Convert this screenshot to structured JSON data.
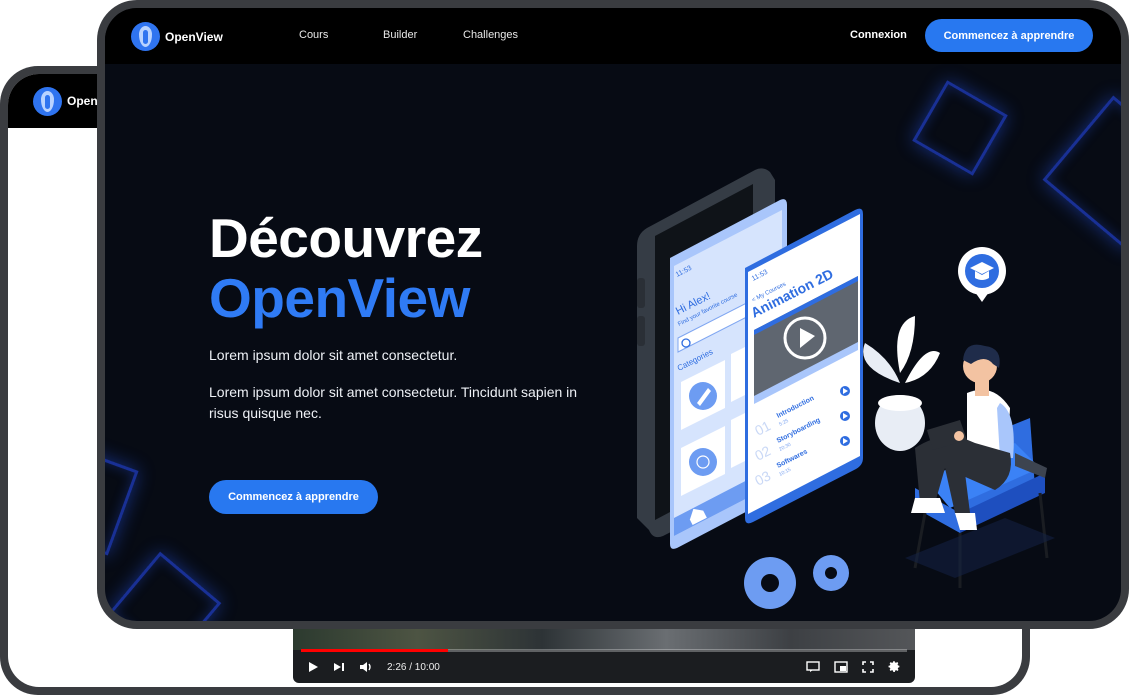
{
  "back_tablet": {
    "brand": "OpenV",
    "video": {
      "time": "2:26 / 10:00",
      "progress": 0.243,
      "icons": [
        "play-icon",
        "next-icon",
        "volume-icon",
        "subtitles-icon",
        "miniplayer-icon",
        "fullscreen-icon",
        "settings-icon"
      ]
    }
  },
  "nav": {
    "brand": "OpenView",
    "links": [
      "Cours",
      "Builder",
      "Challenges"
    ],
    "login": "Connexion",
    "cta": "Commencez à apprendre"
  },
  "hero": {
    "title_line1": "Découvrez",
    "title_line2": "OpenView",
    "paragraph1": "Lorem ipsum dolor sit amet consectetur.",
    "paragraph2": "Lorem ipsum dolor sit amet consectetur. Tincidunt sapien in risus quisque nec.",
    "cta": "Commencez à apprendre"
  },
  "illustration": {
    "phone_time_1": "11:53",
    "phone_time_2": "11:53",
    "greeting": "Hi Alex!",
    "subtitle": "Find your favorite course",
    "categories_label": "Categories",
    "back_link": "< My Courses",
    "course_title": "Animation 2D",
    "lessons": [
      {
        "num": "01",
        "title": "Introduction",
        "duration": "5:25"
      },
      {
        "num": "02",
        "title": "Storyboarding",
        "duration": "20:30"
      },
      {
        "num": "03",
        "title": "Softwares",
        "duration": "10:15"
      }
    ]
  },
  "colors": {
    "accent": "#2878f0",
    "accent_light": "#a9c6fb",
    "background": "#070b14",
    "nav": "#000000"
  }
}
